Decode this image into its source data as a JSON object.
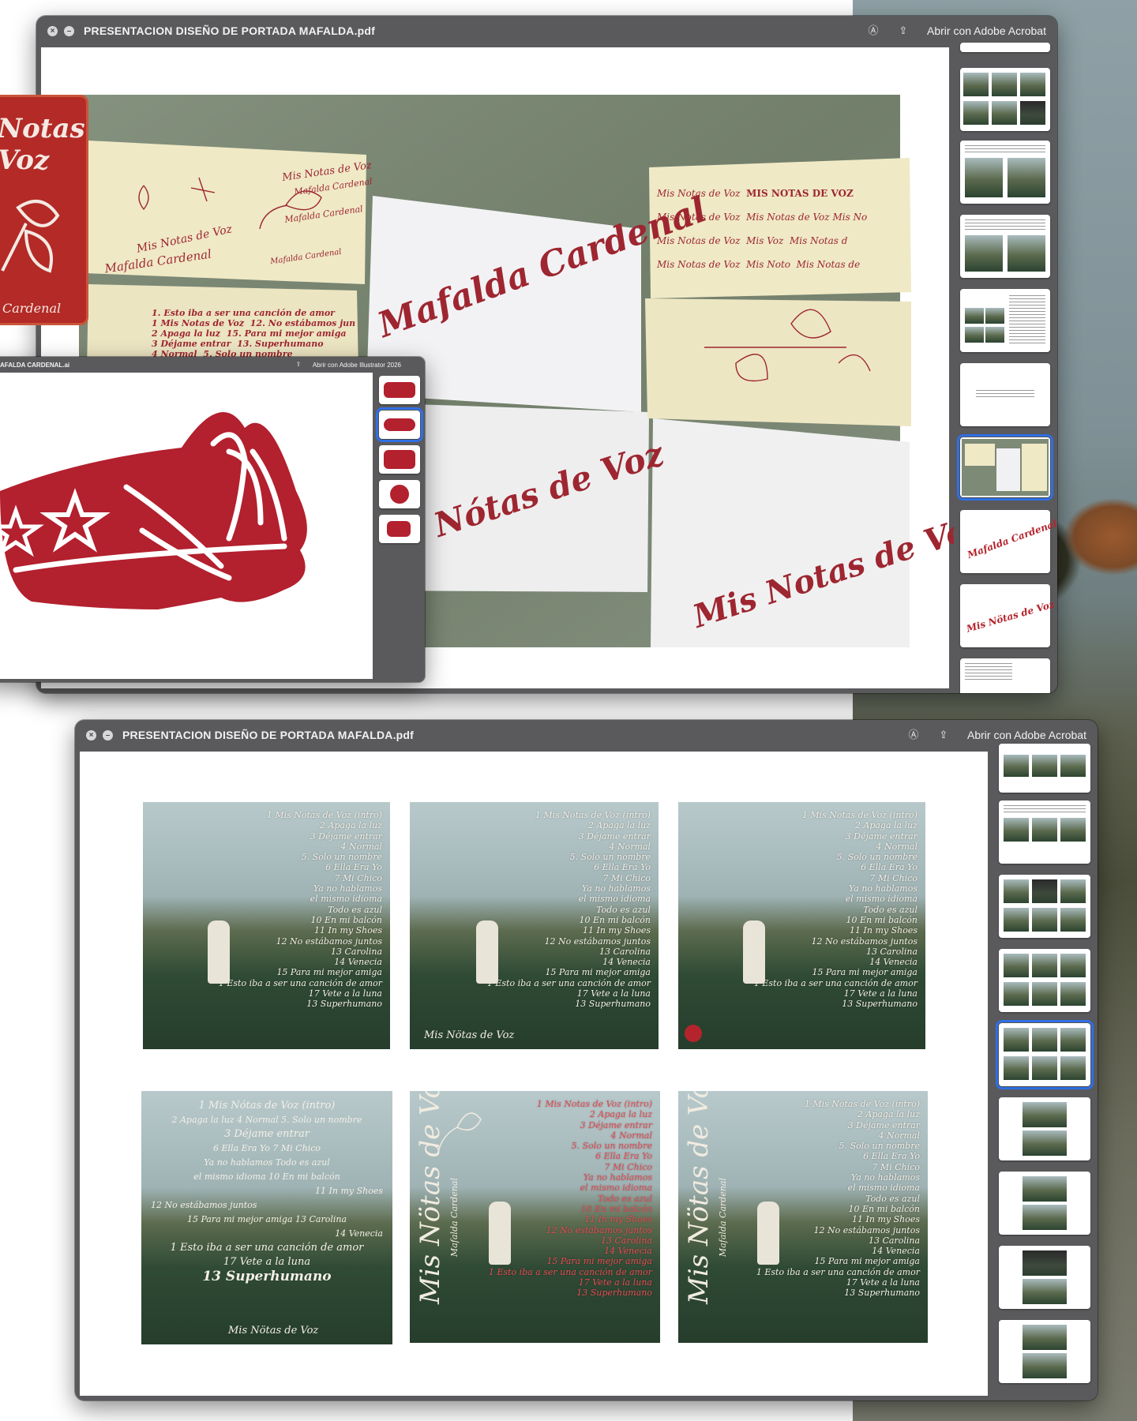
{
  "pdf_window": {
    "title": "PRESENTACION DISEÑO DE PORTADA MAFALDA.pdf",
    "open_with": "Abrir con Adobe Acrobat"
  },
  "ai_window": {
    "title": "AFALDA CARDENAL.ai",
    "open_with": "Abrir con Adobe Illustrator 2026"
  },
  "red_card": {
    "title": "Notas\nVoz",
    "footer": "Cardenal"
  },
  "photo_labels": {
    "sheet1": [
      "Mis Notas de Voz",
      "Mafalda Cardenal",
      "Mis Notas de Voz",
      "Mafalda Cardenal",
      "Mafalda Cardenal",
      "Mafalda Cardenal"
    ],
    "tracks_partial": [
      "1. Esto iba a ser una canción de amor",
      "1 Mis Notas de Voz",
      "12. No estábamos jun",
      "2 Apaga la luz",
      "15. Para mi mejor amiga",
      "3 Déjame entrar",
      "13. Superhumano",
      "4 Normal",
      "5. Solo un nombre"
    ],
    "big_white_1": "Mafalda Cardenal",
    "big_white_2": "is Nótas de Voz",
    "big_white_3": "Mis Notas de Vo",
    "sheet_right": [
      "Mis Notas de Voz",
      "MIS NOTAS DE VOZ",
      "Mis Notas de Voz",
      "Mis Notas de Voz",
      "Mis No",
      "Mis Notas de Voz",
      "Mis Voz",
      "Mis Notas d",
      "Mis Notas de Voz",
      "Mis Noto",
      "Mis Notas de"
    ]
  },
  "tracklist": [
    "1 Mis Notas de Voz (intro)",
    "2 Apaga la luz",
    "3 Déjame entrar",
    "4 Normal",
    "5. Solo un nombre",
    "6 Ella Era Yo",
    "7 Mi Chico",
    "Ya no hablamos",
    "el mismo idioma",
    "Todo es azul",
    "10 En mi balcón",
    "11 In my Shoes",
    "12 No estábamos juntos",
    "13 Carolina",
    "14 Venecia",
    "15 Para mi mejor amiga",
    "1 Esto iba a ser una canción de amor",
    "17 Vete a la luna",
    "13 Superhumano"
  ],
  "cover_signature": "Mis Nötas de Voz",
  "cover_vertical_title": "Mis Nötas de Voz",
  "cover_vertical_sub": "Mafalda Cardenal",
  "cover4_lines": [
    "1 Mis Nótas de Voz (intro)",
    "2 Apaga la luz   4 Normal   5. Solo un nombre",
    "3 Déjame entrar",
    "6 Ella Era Yo              7 Mi Chico",
    "Ya no hablamos   Todo es azul",
    "el mismo idioma      10 En mi balcón",
    "11 In my Shoes",
    "12 No estábamos juntos",
    "15 Para mi mejor amiga   13 Carolina",
    "14 Venecia",
    "1 Esto iba a ser una canción de amor",
    "17 Vete a la luna",
    "13 Superhumano"
  ],
  "thumb_captions": {
    "script1": "Mafalda Cardenal",
    "script2": "Mis Nötas de Voz"
  },
  "colors": {
    "accent_red": "#b5242d",
    "selection_blue": "#2f6fe3",
    "window_gray": "#5a5a5c"
  }
}
